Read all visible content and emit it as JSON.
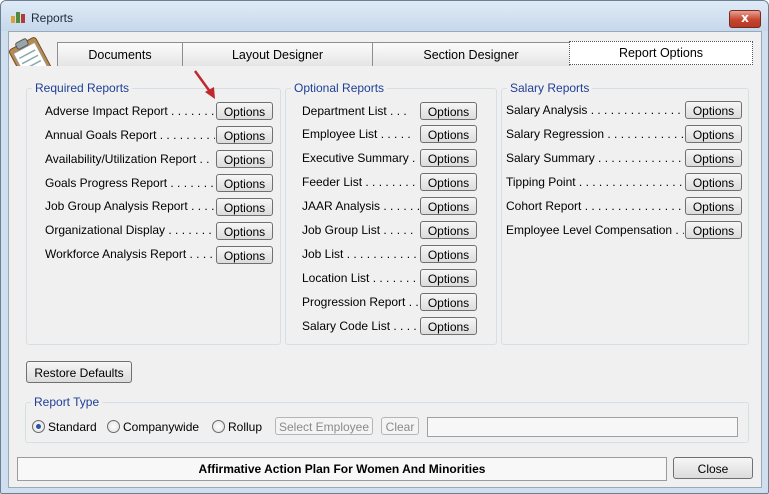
{
  "window": {
    "title": "Reports",
    "close_glyph": "x"
  },
  "tabs": [
    {
      "label": "Documents",
      "active": false
    },
    {
      "label": "Layout Designer",
      "active": false
    },
    {
      "label": "Section Designer",
      "active": false
    },
    {
      "label": "Report Options",
      "active": true
    }
  ],
  "options_label": "Options",
  "required": {
    "title": "Required Reports",
    "items": [
      "Adverse Impact Report . . . . . . . . .",
      "Annual Goals Report . . . . . . . . . .",
      "Availability/Utilization Report . .",
      "Goals Progress Report . . . . . . . .",
      "Job Group Analysis Report . . . .",
      "Organizational Display . . . . . . . .",
      "Workforce Analysis Report . . . ."
    ]
  },
  "optional": {
    "title": "Optional Reports",
    "items": [
      "Department List . . .",
      "Employee List . . . . .",
      "Executive Summary . .",
      "Feeder List . . . . . . . . .",
      "JAAR Analysis . . . . . .",
      "Job Group List . . . . .",
      "Job List . . . . . . . . . . . .",
      "Location List . . . . . . .",
      "Progression Report . .",
      "Salary Code List . . . ."
    ]
  },
  "salary": {
    "title": "Salary Reports",
    "items": [
      "Salary Analysis . . . . . . . . . . . . . . . . .",
      "Salary Regression . . . . . . . . . . . . .",
      "Salary Summary . . . . . . . . . . . . . . .",
      "Tipping Point . . . . . . . . . . . . . . . . . . .",
      "Cohort Report . . . . . . . . . . . . . . . . . .",
      "Employee Level Compensation . ."
    ]
  },
  "restore_label": "Restore Defaults",
  "report_type": {
    "title": "Report Type",
    "options": [
      "Standard",
      "Companywide",
      "Rollup"
    ],
    "selected": "Standard",
    "select_employee_label": "Select Employee",
    "clear_label": "Clear",
    "employee_value": ""
  },
  "status_text": "Affirmative Action Plan For Women And Minorities",
  "close_label": "Close",
  "colors": {
    "legend": "#1f3f96",
    "pointer_arrow": "#c0282d"
  }
}
